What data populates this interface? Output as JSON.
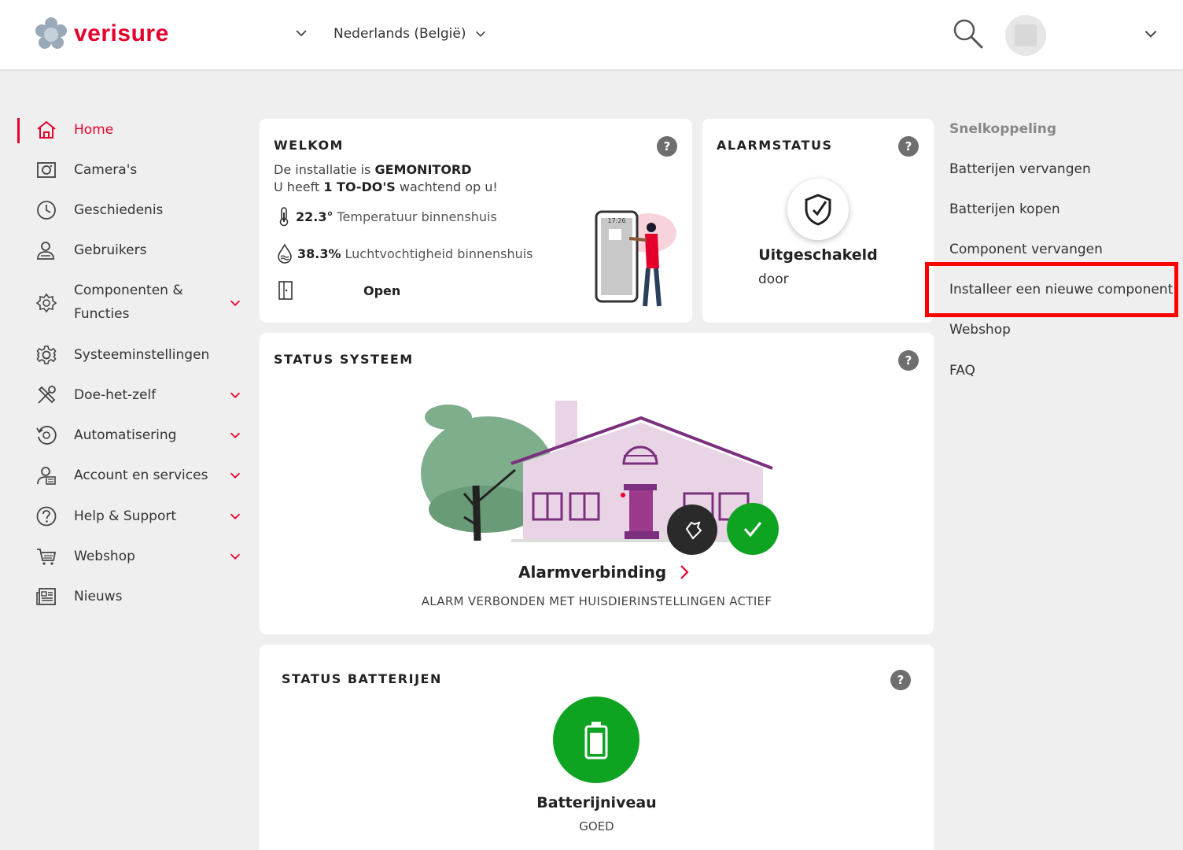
{
  "header": {
    "brand": "verisure",
    "language": "Nederlands (België)"
  },
  "sidebar": {
    "items": [
      {
        "label": "Home",
        "icon": "home-icon"
      },
      {
        "label": "Camera's",
        "icon": "camera-icon"
      },
      {
        "label": "Geschiedenis",
        "icon": "clock-icon"
      },
      {
        "label": "Gebruikers",
        "icon": "users-icon"
      },
      {
        "label": "Componenten &",
        "label2": "Functies",
        "icon": "component-icon"
      },
      {
        "label": "Systeeminstellingen",
        "icon": "gear-icon"
      },
      {
        "label": "Doe-het-zelf",
        "icon": "tools-icon"
      },
      {
        "label": "Automatisering",
        "icon": "automation-icon"
      },
      {
        "label": "Account en services",
        "icon": "account-icon"
      },
      {
        "label": "Help & Support",
        "icon": "question-icon"
      },
      {
        "label": "Webshop",
        "icon": "cart-icon"
      },
      {
        "label": "Nieuws",
        "icon": "news-icon"
      }
    ]
  },
  "welkom": {
    "title": "WELKOM",
    "line1_prefix": "De installatie is",
    "line1_status": "GEMONITORD",
    "line2_prefix": "U heeft",
    "line2_count": "1 TO-DO'S",
    "line2_suffix": "wachtend op u!",
    "temp_value": "22.3°",
    "temp_label": "Temperatuur binnenshuis",
    "humidity_value": "38.3%",
    "humidity_label": "Luchtvochtigheid binnenshuis",
    "door_status": "Open",
    "phone_time": "17:26"
  },
  "alarm": {
    "title": "ALARMSTATUS",
    "status": "Uitgeschakeld",
    "by": "door"
  },
  "systeem": {
    "title": "STATUS SYSTEEM",
    "connection_label": "Alarmverbinding",
    "connection_detail": "ALARM VERBONDEN MET HUISDIERINSTELLINGEN ACTIEF"
  },
  "batterijen": {
    "title": "STATUS BATTERIJEN",
    "label": "Batterijniveau",
    "status": "GOED"
  },
  "quicklinks": {
    "title": "Snelkoppeling",
    "items": [
      "Batterijen vervangen",
      "Batterijen kopen",
      "Component vervangen",
      "Installeer een nieuwe component",
      "Webshop",
      "FAQ"
    ]
  },
  "colors": {
    "brand": "#e4002b",
    "success": "#0ea320",
    "highlight": "#ff0000"
  }
}
